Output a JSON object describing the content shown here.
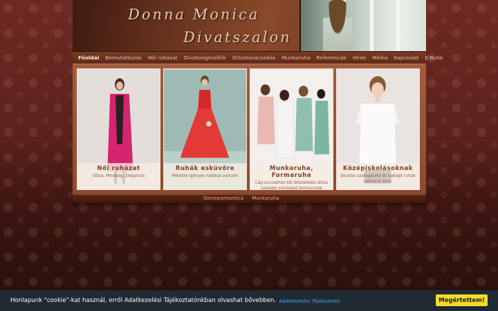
{
  "header": {
    "logo_line1": "Donna Monica",
    "logo_line2": "Divatszalon"
  },
  "nav": {
    "items": [
      {
        "label": "Főoldal",
        "active": true
      },
      {
        "label": "Bemutatkozás"
      },
      {
        "label": "Női ruházat"
      },
      {
        "label": "Divatkiegészítők"
      },
      {
        "label": "Stílustanácsadás"
      },
      {
        "label": "Munkaruha"
      },
      {
        "label": "Referenciák"
      },
      {
        "label": "Hírek"
      },
      {
        "label": "Média"
      },
      {
        "label": "Kapcsolat"
      },
      {
        "label": "E-Butik"
      }
    ]
  },
  "cards": [
    {
      "title": "Női ruházat",
      "subtitle": "Stílus, Minőség, Elegancia"
    },
    {
      "title": "Ruhák esküvőre",
      "subtitle": "Méretre igényes ruhákat varrunk"
    },
    {
      "title": "Munkaruha, Formaruha",
      "subtitle": "Cég arculathoz illő öltözködési stílus Legjobb minőségű formaruhák"
    },
    {
      "title": "Középiskolásoknak",
      "subtitle": "Divatos szalagavató és ballagó ruhák kedvező áron"
    }
  ],
  "footer": {
    "links": [
      "Donnaromantica",
      "Munkaruha"
    ]
  },
  "cookie": {
    "text": "Honlapunk \"cookie\"-kat használ, erről Adatkezelési Tájékoztatónkban olvashat bővebben.",
    "link": "Adatkezelési Tájékoztató",
    "button": "Megértettem!"
  },
  "colors": {
    "background": "#5a211b",
    "cookie_bar": "#1f2a33",
    "cookie_button": "#f3dc2e",
    "accent_text": "#7b3d22"
  }
}
